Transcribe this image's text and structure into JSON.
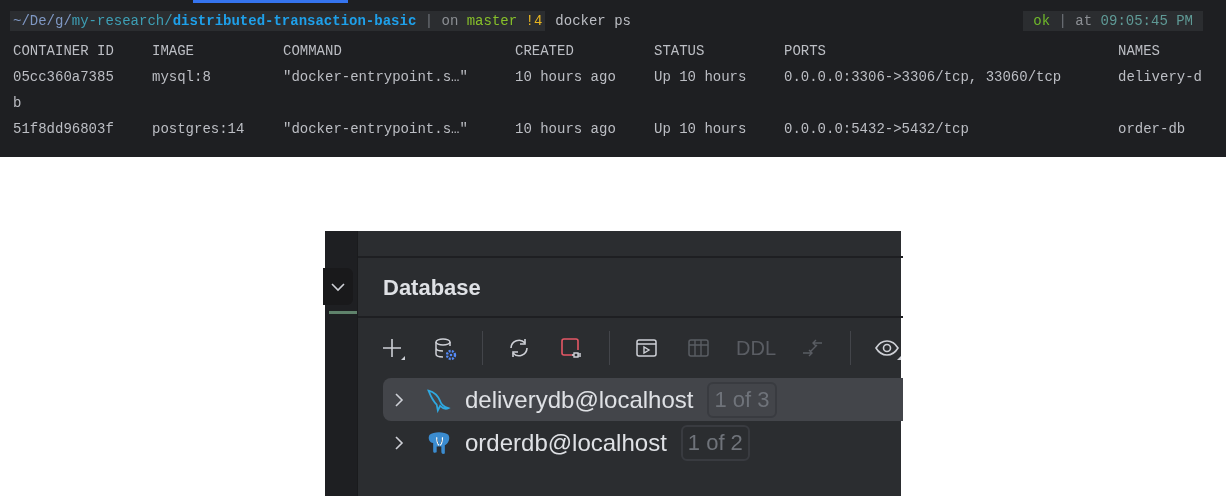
{
  "terminal": {
    "prompt": {
      "path_prefix": "~/De/g/",
      "path_mid": "my-research/",
      "path_dir": "distributed-transaction-basic",
      "separator": "|",
      "branch_label": "on",
      "branch": "master",
      "git_status": "!4"
    },
    "command": "docker ps",
    "result": {
      "status": "ok",
      "separator": "|",
      "time_label": "at",
      "time": "09:05:45 PM"
    },
    "columns": [
      "CONTAINER ID",
      "IMAGE",
      "COMMAND",
      "CREATED",
      "STATUS",
      "PORTS",
      "NAMES"
    ],
    "lines": [
      [
        "05cc360a7385",
        "mysql:8",
        "\"docker-entrypoint.s…\"",
        "10 hours ago",
        "Up 10 hours",
        "0.0.0.0:3306->3306/tcp, 33060/tcp",
        "delivery-d"
      ],
      [
        "b"
      ],
      [
        "51f8dd96803f",
        "postgres:14",
        "\"docker-entrypoint.s…\"",
        "10 hours ago",
        "Up 10 hours",
        "0.0.0.0:5432->5432/tcp",
        "order-db"
      ]
    ]
  },
  "database_panel": {
    "title": "Database",
    "toolbar": [
      {
        "kind": "add",
        "disabled": false
      },
      {
        "kind": "data-source-settings",
        "disabled": false
      },
      {
        "kind": "separator"
      },
      {
        "kind": "refresh",
        "disabled": false
      },
      {
        "kind": "disconnect",
        "disabled": false
      },
      {
        "kind": "separator"
      },
      {
        "kind": "console",
        "disabled": false
      },
      {
        "kind": "table",
        "disabled": true
      },
      {
        "kind": "text",
        "label": "DDL",
        "disabled": true
      },
      {
        "kind": "compare",
        "disabled": true
      },
      {
        "kind": "separator"
      },
      {
        "kind": "view",
        "disabled": false
      }
    ],
    "tree": [
      {
        "kind": "mysql",
        "label": "deliverydb@localhost",
        "badge": "1 of 3",
        "selected": true,
        "expanded": false
      },
      {
        "kind": "postgres",
        "label": "orderdb@localhost",
        "badge": "1 of 2",
        "selected": false,
        "expanded": false
      }
    ]
  }
}
